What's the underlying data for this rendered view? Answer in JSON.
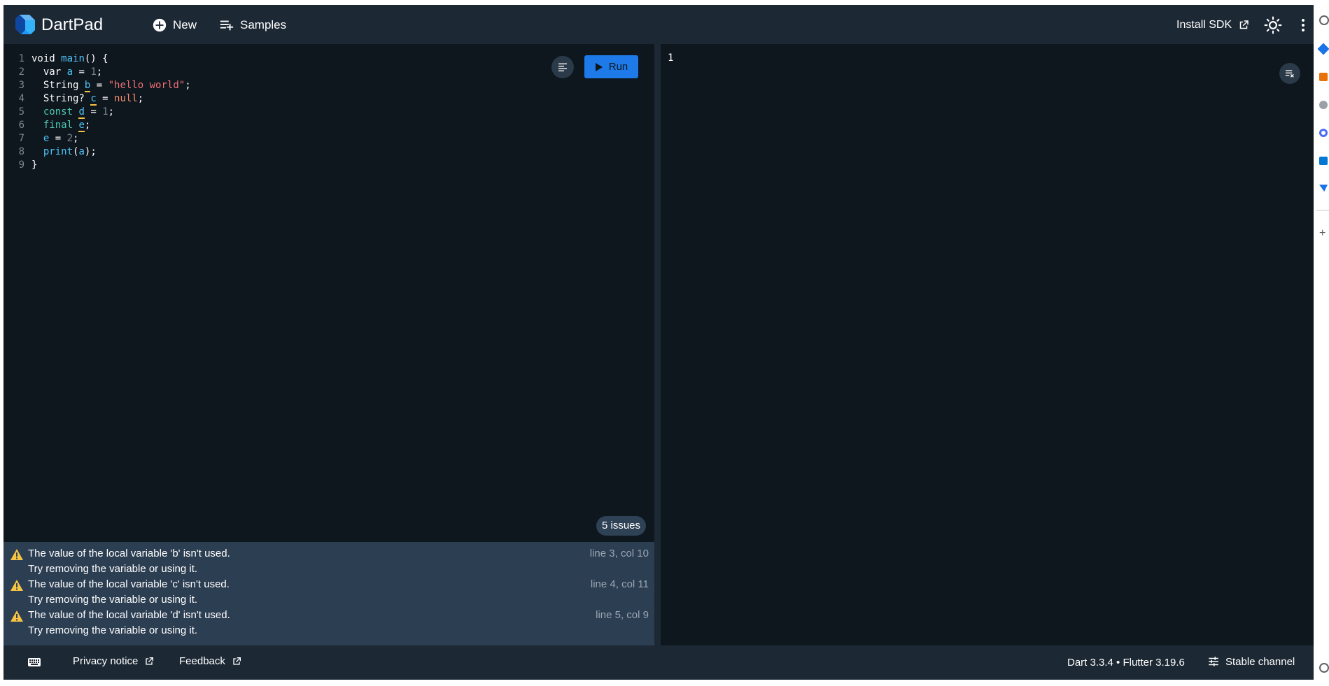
{
  "header": {
    "title": "DartPad",
    "new_label": "New",
    "samples_label": "Samples",
    "install_sdk_label": "Install SDK"
  },
  "editor": {
    "line_numbers": [
      "1",
      "2",
      "3",
      "4",
      "5",
      "6",
      "7",
      "8",
      "9"
    ],
    "run_label": "Run",
    "issues_badge": "5 issues"
  },
  "problems": [
    {
      "message": "The value of the local variable 'b' isn't used.",
      "fix": "Try removing the variable or using it.",
      "location": "line 3, col 10"
    },
    {
      "message": "The value of the local variable 'c' isn't used.",
      "fix": "Try removing the variable or using it.",
      "location": "line 4, col 11"
    },
    {
      "message": "The value of the local variable 'd' isn't used.",
      "fix": "Try removing the variable or using it.",
      "location": "line 5, col 9"
    }
  ],
  "console": {
    "output": "1"
  },
  "footer": {
    "privacy_label": "Privacy notice",
    "feedback_label": "Feedback",
    "version": "Dart 3.3.4 • Flutter 3.19.6",
    "channel_label": "Stable channel"
  },
  "colors": {
    "background": "#1c2834",
    "editor": "#0e161e",
    "problems": "#2c3e52",
    "accent": "#1e7ae8",
    "warning": "#f6c343"
  },
  "icons": {
    "logo": "dart-logo-icon",
    "new": "add-circle-icon",
    "samples": "playlist-add-icon",
    "install": "open-in-new-icon",
    "theme": "brightness-icon",
    "menu": "more-vert-icon",
    "format": "format-align-icon",
    "run": "play-icon",
    "clear": "clear-all-icon",
    "warning": "warning-icon",
    "keyboard": "keyboard-icon",
    "channel": "tune-icon"
  }
}
